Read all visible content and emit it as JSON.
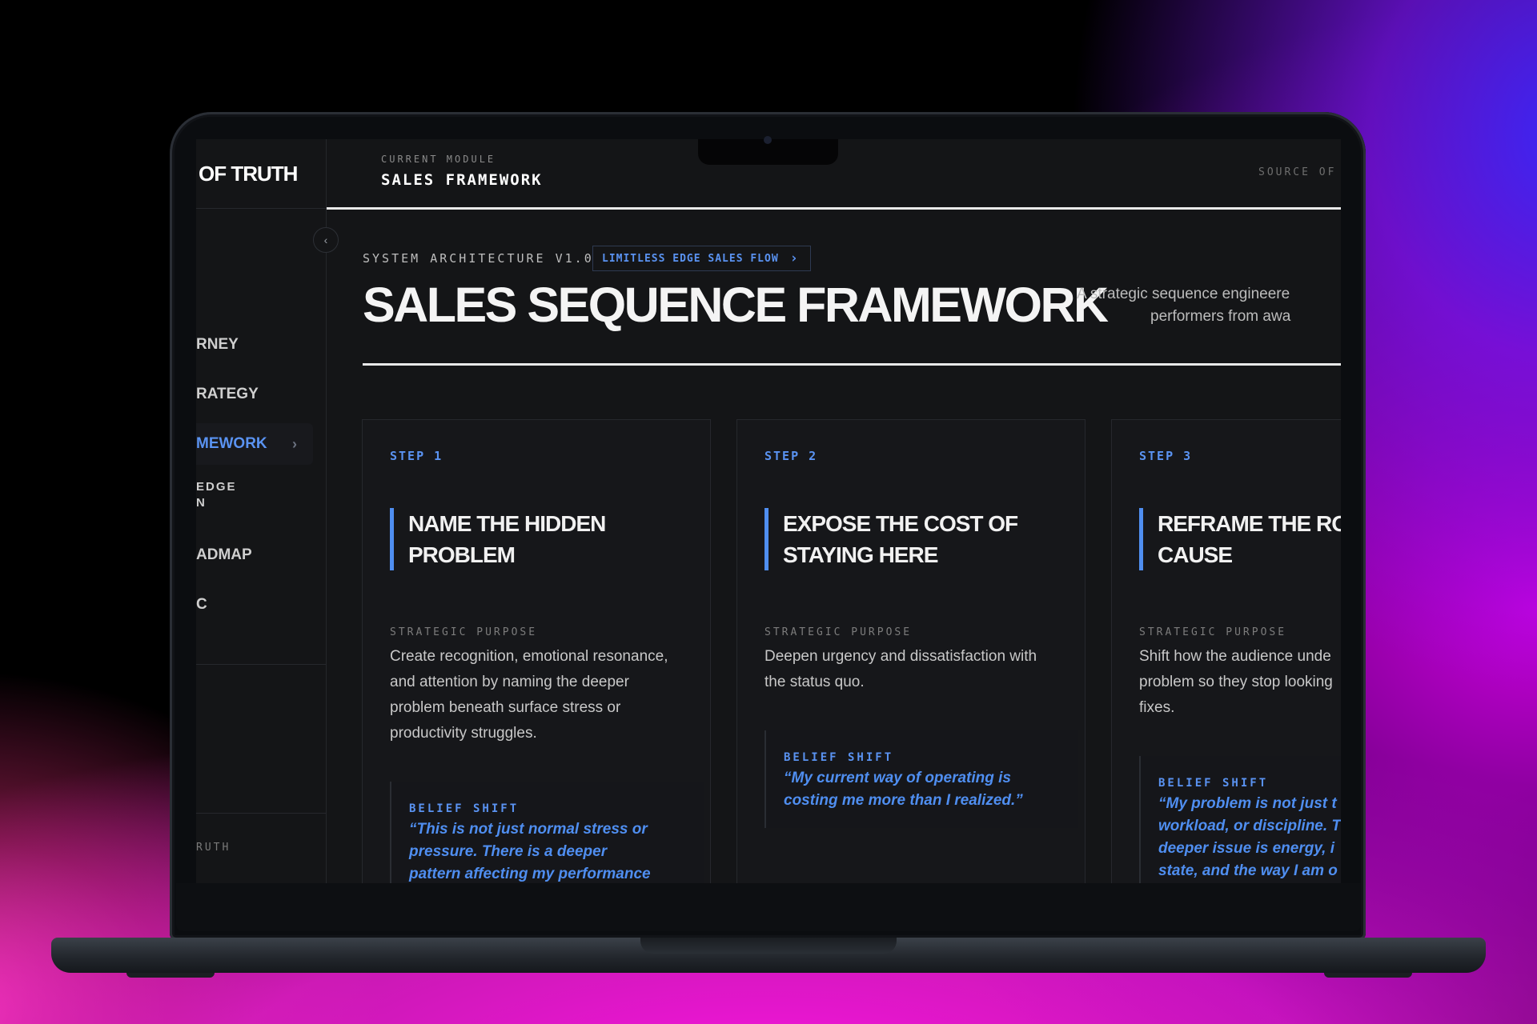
{
  "app": {
    "brand": "OF TRUTH",
    "footer_label": "RUTH"
  },
  "sidebar": {
    "collapse_icon": "chevron-left-icon",
    "items": [
      {
        "label": "RNEY",
        "active": false
      },
      {
        "label": "RATEGY",
        "active": false
      },
      {
        "label": "MEWORK",
        "active": true
      },
      {
        "label": "EDGE\nN",
        "active": false
      },
      {
        "label": "ADMAP",
        "active": false
      },
      {
        "label": "C",
        "active": false
      }
    ]
  },
  "header": {
    "kicker": "CURRENT MODULE",
    "title": "SALES FRAMEWORK",
    "right_label": "SOURCE OF TR"
  },
  "hero": {
    "kicker": "SYSTEM ARCHITECTURE V1.0",
    "flow_link": "LIMITLESS EDGE SALES FLOW",
    "title": "SALES SEQUENCE FRAMEWORK",
    "description_line1": "A strategic sequence engineere",
    "description_line2": "performers from awa"
  },
  "cards": [
    {
      "step": "STEP 1",
      "title_line1": "NAME THE HIDDEN",
      "title_line2": "PROBLEM",
      "purpose_label": "STRATEGIC PURPOSE",
      "purpose_lines": [
        "Create recognition, emotional resonance,",
        "and attention by naming the deeper",
        "problem beneath surface stress or",
        "productivity struggles."
      ],
      "belief_label": "BELIEF SHIFT",
      "belief_lines": [
        "“This is not just normal stress or",
        "pressure. There is a deeper",
        "pattern affecting my performance"
      ]
    },
    {
      "step": "STEP 2",
      "title_line1": "EXPOSE THE COST OF",
      "title_line2": "STAYING HERE",
      "purpose_label": "STRATEGIC PURPOSE",
      "purpose_lines": [
        "Deepen urgency and dissatisfaction with",
        "the status quo."
      ],
      "belief_label": "BELIEF SHIFT",
      "belief_lines": [
        "“My current way of operating is",
        "costing me more than I realized.”"
      ]
    },
    {
      "step": "STEP 3",
      "title_line1": "REFRAME THE ROO",
      "title_line2": "CAUSE",
      "purpose_label": "STRATEGIC PURPOSE",
      "purpose_lines": [
        "Shift how the audience unde",
        "problem so they stop looking",
        "fixes."
      ],
      "belief_label": "BELIEF SHIFT",
      "belief_lines": [
        "“My problem is not just t",
        "workload, or discipline. T",
        "deeper issue is energy, i",
        "state, and the way I am o"
      ]
    }
  ]
}
